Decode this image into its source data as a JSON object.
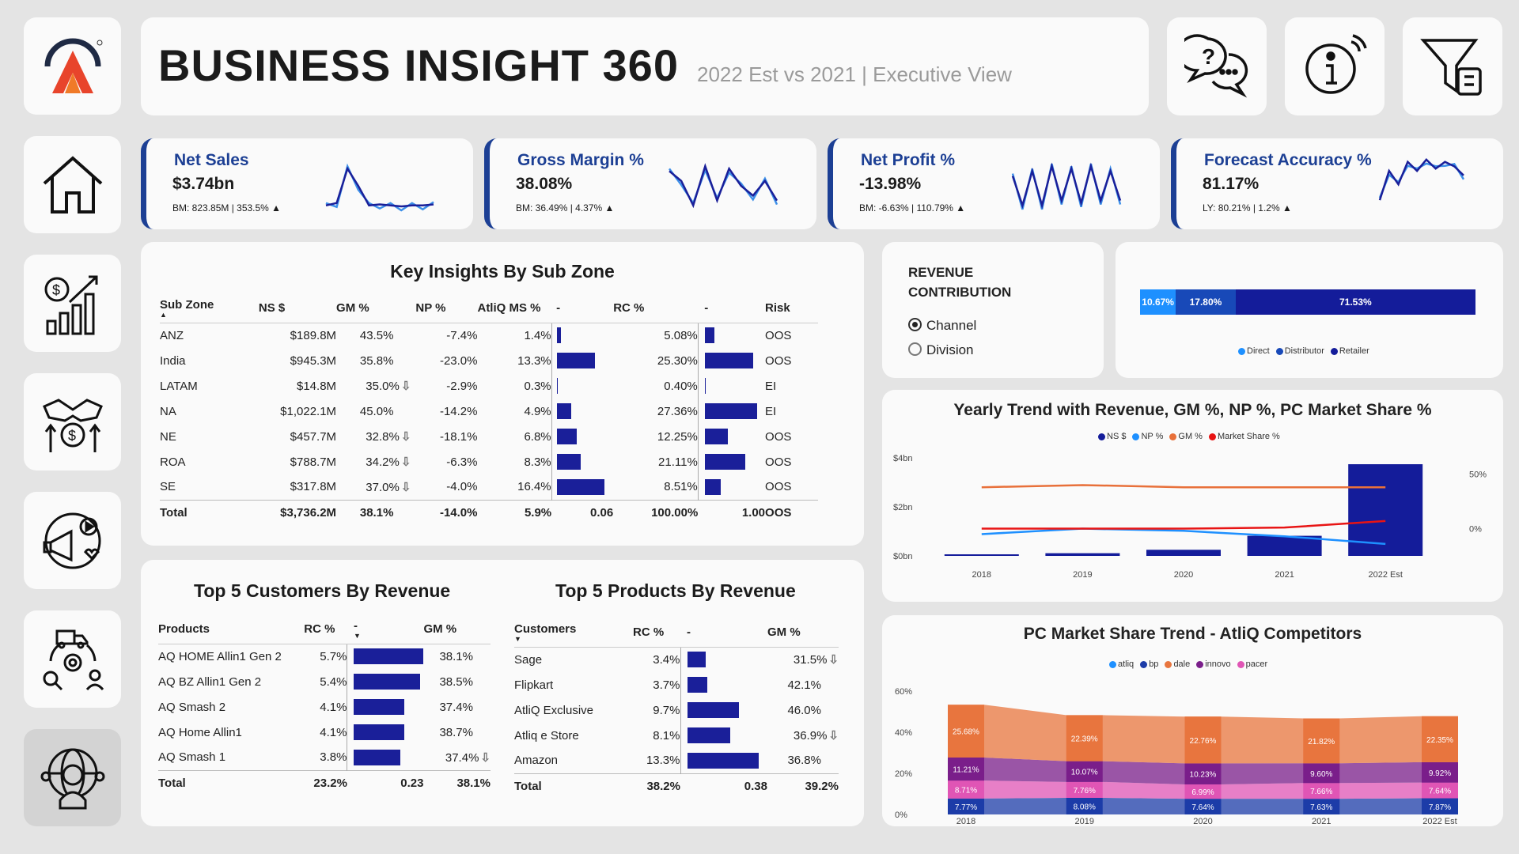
{
  "header": {
    "title": "BUSINESS INSIGHT 360",
    "subtitle": "2022 Est vs 2021 | Executive View"
  },
  "top_icons": [
    "help-chat-icon",
    "info-icon",
    "filter-icon"
  ],
  "sidebar": [
    "home-icon",
    "finance-growth-icon",
    "sales-handshake-icon",
    "marketing-icon",
    "supply-chain-icon",
    "executive-globe-icon"
  ],
  "kpis": [
    {
      "label": "Net Sales",
      "value": "$3.74bn",
      "bm": "BM: 823.85M | 353.5% ▲",
      "trend": [
        0.1,
        0.15,
        0.85,
        0.5,
        0.1,
        0.12,
        0.1,
        0.08,
        0.1,
        0.1,
        0.12
      ]
    },
    {
      "label": "Gross Margin %",
      "value": "38.08%",
      "bm": "BM: 36.49% | 4.37% ▲",
      "trend": [
        0.8,
        0.6,
        0.1,
        0.9,
        0.2,
        0.85,
        0.5,
        0.3,
        0.6,
        0.2
      ]
    },
    {
      "label": "Net Profit %",
      "value": "-13.98%",
      "bm": "BM: -6.63% | 110.79% ▲",
      "trend": [
        0.7,
        0.1,
        0.8,
        0.1,
        0.9,
        0.2,
        0.85,
        0.15,
        0.9,
        0.2,
        0.8,
        0.2
      ]
    },
    {
      "label": "Forecast Accuracy %",
      "value": "81.17%",
      "bm": "LY: 80.21% | 1.2% ▲",
      "trend": [
        0.05,
        0.7,
        0.4,
        0.9,
        0.7,
        0.95,
        0.75,
        0.9,
        0.8,
        0.6
      ]
    }
  ],
  "subzone": {
    "title": "Key Insights By Sub Zone",
    "headers": [
      "Sub Zone",
      "NS $",
      "GM %",
      "NP %",
      "AtliQ MS %",
      "-",
      "RC %",
      "-",
      "Risk"
    ],
    "rows": [
      {
        "zone": "ANZ",
        "ns": "$189.8M",
        "gm": "43.5%",
        "gm_down": false,
        "np": "-7.4%",
        "ms": "1.4%",
        "ms_v": 1.4,
        "rc": "5.08%",
        "rc_v": 5.08,
        "risk": "OOS"
      },
      {
        "zone": "India",
        "ns": "$945.3M",
        "gm": "35.8%",
        "gm_down": false,
        "np": "-23.0%",
        "ms": "13.3%",
        "ms_v": 13.3,
        "rc": "25.30%",
        "rc_v": 25.3,
        "risk": "OOS"
      },
      {
        "zone": "LATAM",
        "ns": "$14.8M",
        "gm": "35.0%",
        "gm_down": true,
        "np": "-2.9%",
        "ms": "0.3%",
        "ms_v": 0.3,
        "rc": "0.40%",
        "rc_v": 0.4,
        "risk": "EI"
      },
      {
        "zone": "NA",
        "ns": "$1,022.1M",
        "gm": "45.0%",
        "gm_down": false,
        "np": "-14.2%",
        "ms": "4.9%",
        "ms_v": 4.9,
        "rc": "27.36%",
        "rc_v": 27.36,
        "risk": "EI"
      },
      {
        "zone": "NE",
        "ns": "$457.7M",
        "gm": "32.8%",
        "gm_down": true,
        "np": "-18.1%",
        "ms": "6.8%",
        "ms_v": 6.8,
        "rc": "12.25%",
        "rc_v": 12.25,
        "risk": "OOS"
      },
      {
        "zone": "ROA",
        "ns": "$788.7M",
        "gm": "34.2%",
        "gm_down": true,
        "np": "-6.3%",
        "ms": "8.3%",
        "ms_v": 8.3,
        "rc": "21.11%",
        "rc_v": 21.11,
        "risk": "OOS"
      },
      {
        "zone": "SE",
        "ns": "$317.8M",
        "gm": "37.0%",
        "gm_down": true,
        "np": "-4.0%",
        "ms": "16.4%",
        "ms_v": 16.4,
        "rc": "8.51%",
        "rc_v": 8.51,
        "risk": "OOS"
      }
    ],
    "total": {
      "zone": "Total",
      "ns": "$3,736.2M",
      "gm": "38.1%",
      "np": "-14.0%",
      "ms": "5.9%",
      "ms_bar": "0.06",
      "rc": "100.00%",
      "rc_bar": "1.00",
      "risk": "OOS"
    }
  },
  "revenue_contribution": {
    "title1": "REVENUE",
    "title2": "CONTRIBUTION",
    "options": [
      {
        "label": "Channel",
        "selected": true
      },
      {
        "label": "Division",
        "selected": false
      }
    ],
    "segments": [
      {
        "name": "Direct",
        "value": 10.67,
        "label": "10.67%",
        "color": "#1e90ff"
      },
      {
        "name": "Distributor",
        "value": 17.8,
        "label": "17.80%",
        "color": "#1849b8"
      },
      {
        "name": "Retailer",
        "value": 71.53,
        "label": "71.53%",
        "color": "#141c9a"
      }
    ]
  },
  "top_customers": {
    "title": "Top 5 Customers By Revenue",
    "headers": [
      "Products",
      "RC %",
      "-",
      "GM %"
    ],
    "rows": [
      {
        "name": "AQ HOME Allin1 Gen 2",
        "rc": "5.7%",
        "rc_v": 5.7,
        "gm": "38.1%",
        "down": false
      },
      {
        "name": "AQ BZ Allin1 Gen 2",
        "rc": "5.4%",
        "rc_v": 5.4,
        "gm": "38.5%",
        "down": false
      },
      {
        "name": "AQ Smash 2",
        "rc": "4.1%",
        "rc_v": 4.1,
        "gm": "37.4%",
        "down": false
      },
      {
        "name": "AQ Home Allin1",
        "rc": "4.1%",
        "rc_v": 4.1,
        "gm": "38.7%",
        "down": false
      },
      {
        "name": "AQ Smash 1",
        "rc": "3.8%",
        "rc_v": 3.8,
        "gm": "37.4%",
        "down": true
      }
    ],
    "total": {
      "name": "Total",
      "rc": "23.2%",
      "bar": "0.23",
      "gm": "38.1%"
    }
  },
  "top_products": {
    "title": "Top 5 Products By Revenue",
    "headers": [
      "Customers",
      "RC %",
      "-",
      "GM %"
    ],
    "rows": [
      {
        "name": "Sage",
        "rc": "3.4%",
        "rc_v": 3.4,
        "gm": "31.5%",
        "down": true
      },
      {
        "name": "Flipkart",
        "rc": "3.7%",
        "rc_v": 3.7,
        "gm": "42.1%",
        "down": false
      },
      {
        "name": "AtliQ Exclusive",
        "rc": "9.7%",
        "rc_v": 9.7,
        "gm": "46.0%",
        "down": false
      },
      {
        "name": "Atliq e Store",
        "rc": "8.1%",
        "rc_v": 8.1,
        "gm": "36.9%",
        "down": true
      },
      {
        "name": "Amazon",
        "rc": "13.3%",
        "rc_v": 13.3,
        "gm": "36.8%",
        "down": false
      }
    ],
    "total": {
      "name": "Total",
      "rc": "38.2%",
      "bar": "0.38",
      "gm": "39.2%"
    }
  },
  "yearly_trend": {
    "title": "Yearly Trend with Revenue, GM %, NP %, PC Market Share %",
    "legend": [
      {
        "name": "NS $",
        "color": "#141c9a"
      },
      {
        "name": "NP %",
        "color": "#1e90ff"
      },
      {
        "name": "GM %",
        "color": "#e8703a"
      },
      {
        "name": "Market Share %",
        "color": "#e81414"
      }
    ],
    "y_left_ticks": [
      "$4bn",
      "$2bn",
      "$0bn"
    ],
    "y_right_ticks": [
      "50%",
      "0%"
    ],
    "chart_data": {
      "type": "bar",
      "categories": [
        "2018",
        "2019",
        "2020",
        "2021",
        "2022 Est"
      ],
      "series": [
        {
          "name": "NS $",
          "type": "bar",
          "values": [
            0.03,
            0.11,
            0.25,
            0.82,
            3.74
          ]
        },
        {
          "name": "GM %",
          "type": "line",
          "values": [
            38,
            40,
            38,
            38,
            38
          ]
        },
        {
          "name": "NP %",
          "type": "line",
          "values": [
            -5,
            0,
            -2,
            -7,
            -14
          ]
        },
        {
          "name": "Market Share %",
          "type": "line",
          "values": [
            0,
            0,
            0,
            1,
            7
          ]
        }
      ],
      "ylim": [
        0,
        4
      ],
      "y2lim": [
        -25,
        65
      ]
    }
  },
  "market_share": {
    "title": "PC Market Share Trend - AtliQ Competitors",
    "legend": [
      {
        "name": "atliq",
        "color": "#1e90ff"
      },
      {
        "name": "bp",
        "color": "#1c3ca8"
      },
      {
        "name": "dale",
        "color": "#e8753e"
      },
      {
        "name": "innovo",
        "color": "#7a1e8a"
      },
      {
        "name": "pacer",
        "color": "#e055b5"
      }
    ],
    "y_ticks": [
      "60%",
      "40%",
      "20%",
      "0%"
    ],
    "chart_data": {
      "type": "area",
      "categories": [
        "2018",
        "2019",
        "2020",
        "2021",
        "2022 Est"
      ],
      "series": [
        {
          "name": "atliq",
          "values": [
            null,
            null,
            null,
            null,
            null
          ]
        },
        {
          "name": "bp",
          "values": [
            7.77,
            8.08,
            7.64,
            7.63,
            7.87
          ]
        },
        {
          "name": "pacer",
          "values": [
            8.71,
            7.76,
            6.99,
            7.66,
            7.64
          ]
        },
        {
          "name": "innovo",
          "values": [
            11.21,
            10.07,
            10.23,
            9.6,
            9.92
          ]
        },
        {
          "name": "dale",
          "values": [
            25.68,
            22.39,
            22.76,
            21.82,
            22.35
          ]
        }
      ],
      "ylim": [
        0,
        60
      ]
    }
  }
}
